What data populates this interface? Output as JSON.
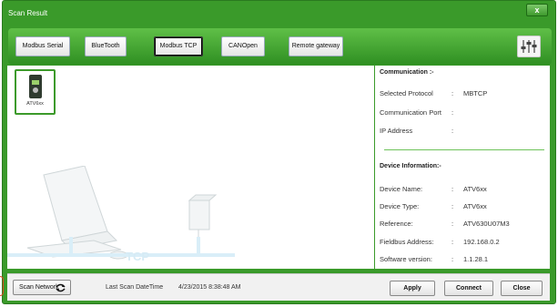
{
  "window": {
    "title": "Scan Result",
    "close_label": "x"
  },
  "tabs": [
    {
      "label": "Modbus Serial",
      "active": false
    },
    {
      "label": "BlueTooth",
      "active": false
    },
    {
      "label": "Modbus TCP",
      "active": true
    },
    {
      "label": "CANOpen",
      "active": false
    },
    {
      "label": "Remote gateway",
      "active": false
    }
  ],
  "settings_icon": "settings-sliders-icon",
  "device": {
    "label": "ATV6xx",
    "icon": "drive-device-icon"
  },
  "illustration": {
    "network_label": "TCP"
  },
  "communication": {
    "header": "Communication :-",
    "rows": [
      {
        "key": "Selected Protocol",
        "sep": ":",
        "value": "MBTCP"
      },
      {
        "key": "Communication Port",
        "sep": ":",
        "value": ""
      },
      {
        "key": "IP Address",
        "sep": ":",
        "value": ""
      }
    ]
  },
  "device_info": {
    "header": "Device Information:-",
    "rows": [
      {
        "key": "Device Name:",
        "sep": ":",
        "value": "ATV6xx"
      },
      {
        "key": "Device Type:",
        "sep": ":",
        "value": "ATV6xx"
      },
      {
        "key": "Reference:",
        "sep": ":",
        "value": "ATV630U07M3"
      },
      {
        "key": "Fieldbus Address:",
        "sep": ":",
        "value": "192.168.0.2"
      },
      {
        "key": "Software version:",
        "sep": ":",
        "value": "1.1.28.1"
      }
    ]
  },
  "bottom": {
    "scan_label": "Scan Network",
    "last_scan_label": "Last Scan DateTime",
    "last_scan_value": "4/23/2015 8:38:48 AM",
    "apply_label": "Apply",
    "connect_label": "Connect",
    "close_label": "Close"
  },
  "colors": {
    "accent": "#3a9a2a",
    "tab_bar": "#4caf3a",
    "divider": "#6dc35a"
  }
}
